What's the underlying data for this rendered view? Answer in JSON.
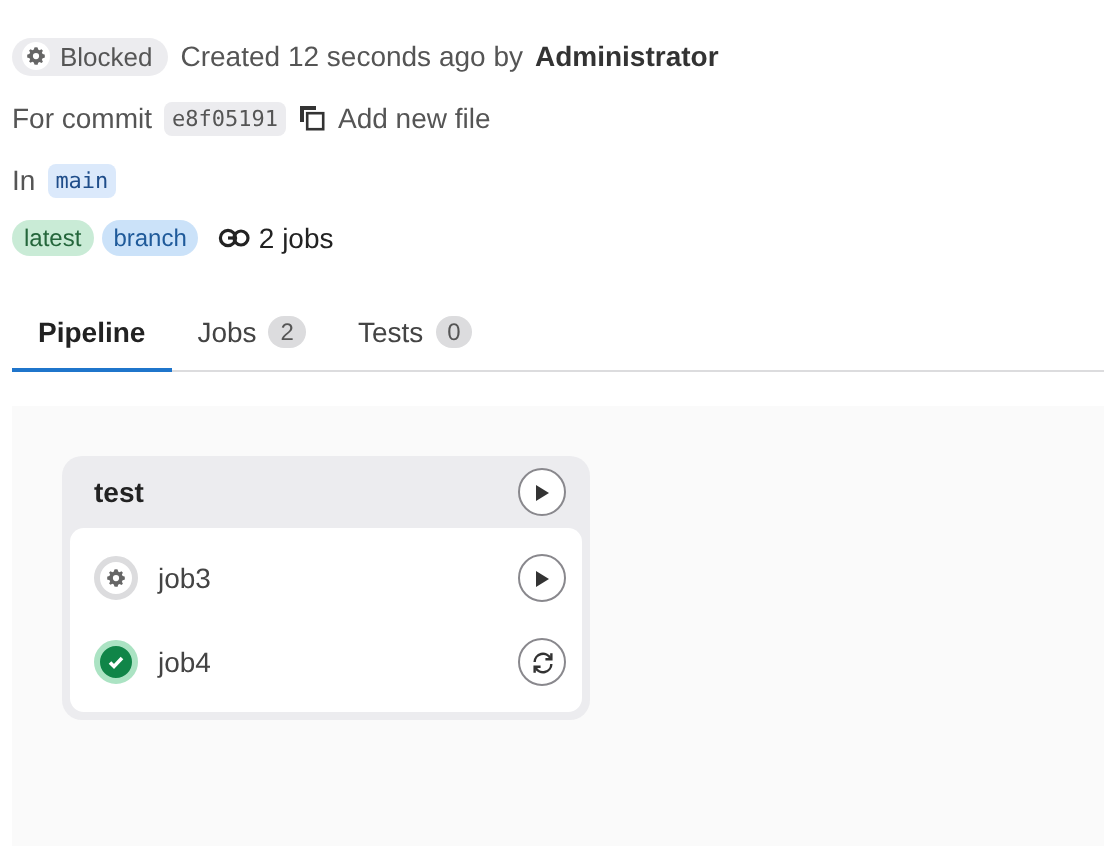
{
  "header": {
    "status": "Blocked",
    "kind": "manual",
    "created": "Created 12 seconds ago by",
    "author": "Administrator"
  },
  "commit": {
    "label": "For commit",
    "sha": "e8f05191",
    "message": "Add new file"
  },
  "ref": {
    "label": "In",
    "branch": "main"
  },
  "badges": [
    {
      "label": "latest",
      "kind": "green"
    },
    {
      "label": "branch",
      "kind": "blue"
    }
  ],
  "jobs_count": "2 jobs",
  "tabs": [
    {
      "label": "Pipeline",
      "selected": true
    },
    {
      "label": "Jobs",
      "count": "2",
      "selected": false
    },
    {
      "label": "Tests",
      "count": "0",
      "selected": false
    }
  ],
  "stage": {
    "name": "test",
    "button": {
      "kind": "play"
    },
    "jobs": [
      {
        "name": "job3",
        "kind": "manual",
        "button": {
          "kind": "play"
        }
      },
      {
        "name": "job4",
        "kind": "success",
        "button": {
          "kind": "retry"
        }
      }
    ]
  }
}
